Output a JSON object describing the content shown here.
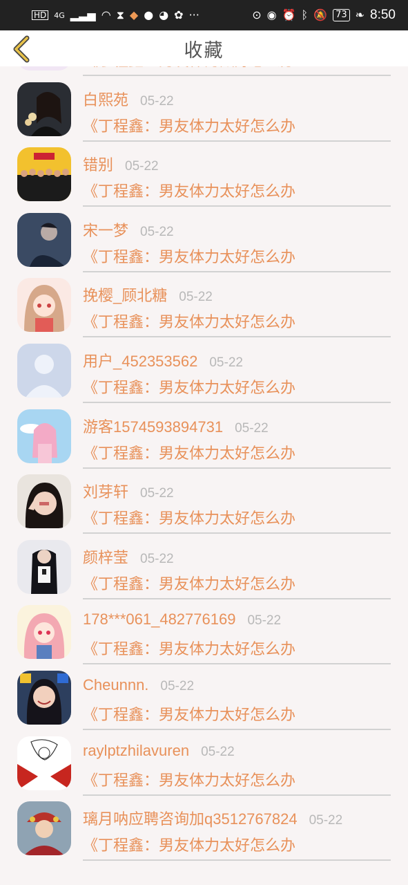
{
  "status_bar": {
    "network_label": "HD",
    "network_type": "4G",
    "battery": "73",
    "time": "8:50"
  },
  "header": {
    "title": "收藏",
    "back_icon": "chevron-left-icon",
    "accent_color": "#e8c24a"
  },
  "colors": {
    "text_accent": "#e8915a",
    "date_text": "#b8b8b8",
    "background": "#f8f4f4"
  },
  "items": [
    {
      "username": "",
      "date": "",
      "post_title": "《丁程鑫：男友体力太好怎么办",
      "avatar": "anime-bunny-avatar"
    },
    {
      "username": "白熙苑",
      "date": "05-22",
      "post_title": "《丁程鑫：男友体力太好怎么办",
      "avatar": "girl-flowers-avatar"
    },
    {
      "username": "错别",
      "date": "05-22",
      "post_title": "《丁程鑫：男友体力太好怎么办",
      "avatar": "group-photo-avatar"
    },
    {
      "username": "宋一梦",
      "date": "05-22",
      "post_title": "《丁程鑫：男友体力太好怎么办",
      "avatar": "boy-night-avatar"
    },
    {
      "username": "挽樱_顾北糖",
      "date": "05-22",
      "post_title": "《丁程鑫：男友体力太好怎么办",
      "avatar": "anime-girl-avatar"
    },
    {
      "username": "用户_452353562",
      "date": "05-22",
      "post_title": "《丁程鑫：男友体力太好怎么办",
      "avatar": "default-user-avatar"
    },
    {
      "username": "游客1574593894731",
      "date": "05-22",
      "post_title": "《丁程鑫：男友体力太好怎么办",
      "avatar": "anime-sky-avatar"
    },
    {
      "username": "刘芽轩",
      "date": "05-22",
      "post_title": "《丁程鑫：男友体力太好怎么办",
      "avatar": "girl-peace-avatar"
    },
    {
      "username": "颜梓莹",
      "date": "05-22",
      "post_title": "《丁程鑫：男友体力太好怎么办",
      "avatar": "girl-uniform-avatar"
    },
    {
      "username": "178***061_482776169",
      "date": "05-22",
      "post_title": "《丁程鑫：男友体力太好怎么办",
      "avatar": "anime-pink-hair-avatar"
    },
    {
      "username": "Cheunnn.",
      "date": "05-22",
      "post_title": "《丁程鑫：男友体力太好怎么办",
      "avatar": "girl-smile-avatar"
    },
    {
      "username": "raylptzhilavuren",
      "date": "05-22",
      "post_title": "《丁程鑫：男友体力太好怎么办",
      "avatar": "sketch-red-avatar"
    },
    {
      "username": "璃月呐应聘咨询加q3512767824",
      "date": "05-22",
      "post_title": "《丁程鑫：男友体力太好怎么办",
      "avatar": "opera-costume-avatar"
    }
  ]
}
